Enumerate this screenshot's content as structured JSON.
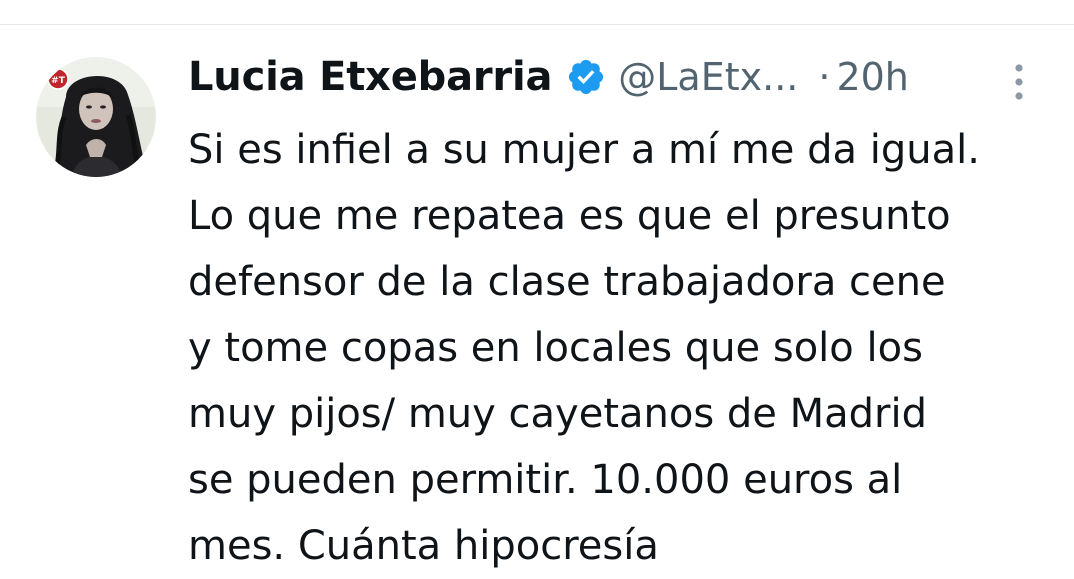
{
  "tweet": {
    "author": {
      "display_name": "Lucia Etxebarria",
      "handle": "@LaEtx...",
      "verified": true,
      "avatar_badge": "#T"
    },
    "separator": "·",
    "time": "20h",
    "text_lines": [
      "Si es infiel a su mujer a mí me da igual.",
      "Lo que me repatea es que el presunto",
      "defensor de la clase trabajadora cene",
      "y tome copas en locales que solo los",
      "muy pijos/ muy cayetanos de Madrid",
      "se pueden permitir. 10.000 euros al",
      "mes. Cuánta hipocresía"
    ]
  },
  "icons": {
    "verified": "verified-badge-icon",
    "more": "more-vertical-icon"
  },
  "colors": {
    "verified_blue": "#1d9bf0",
    "secondary_text": "#536471",
    "primary_text": "#0f1419",
    "divider": "#e6e9ec",
    "avatar_badge_red": "#c0262d"
  }
}
